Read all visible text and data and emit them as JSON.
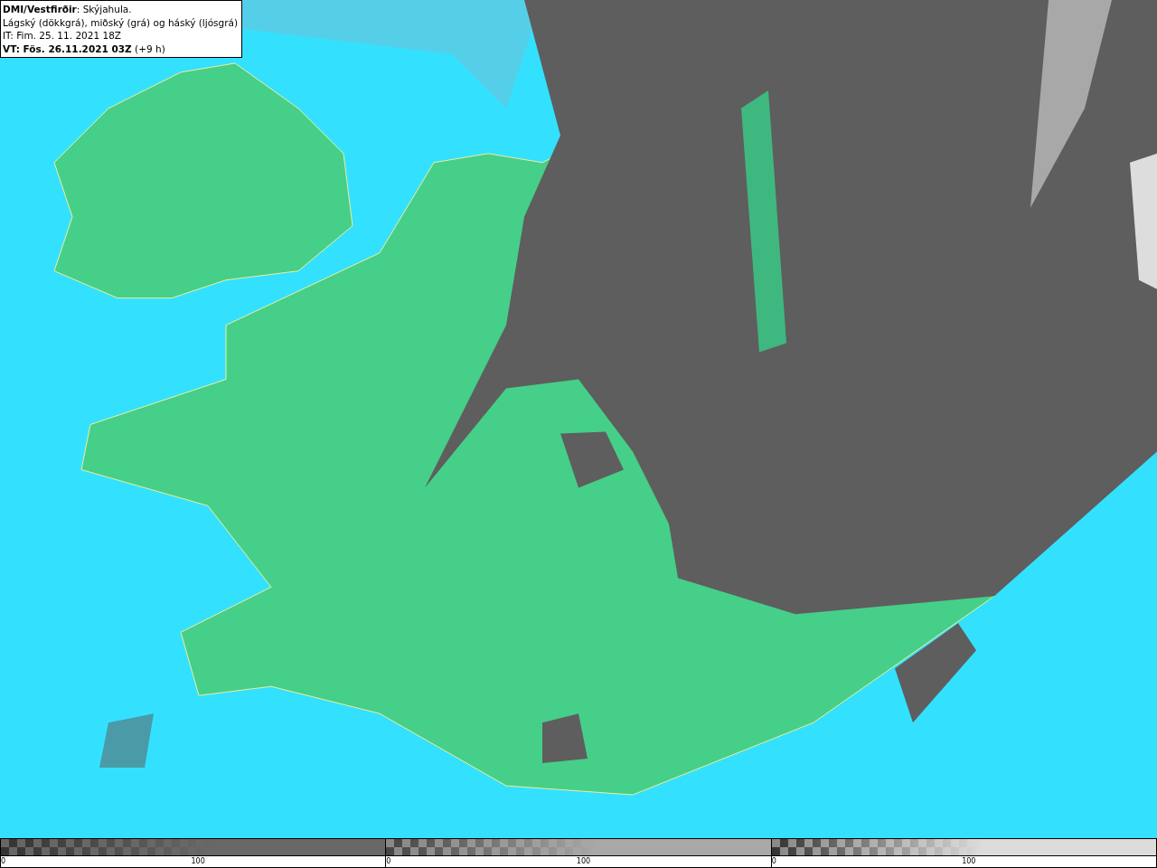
{
  "legend": {
    "lines": [
      "**DMI/Vestfirðir**: Skýjahula.",
      "Lágský (dökkgrá), miðský (grá) og háský (ljósgrá)",
      "IT: Fim. 25. 11. 2021 18Z",
      "**VT: Fös. 26.11.2021 03Z** (+9 h)"
    ]
  },
  "colorbars": [
    {
      "kind": "dark",
      "ticks": [
        "0",
        "100"
      ]
    },
    {
      "kind": "mid",
      "ticks": [
        "0",
        "100"
      ]
    },
    {
      "kind": "light",
      "ticks": [
        "0",
        "100"
      ]
    }
  ]
}
